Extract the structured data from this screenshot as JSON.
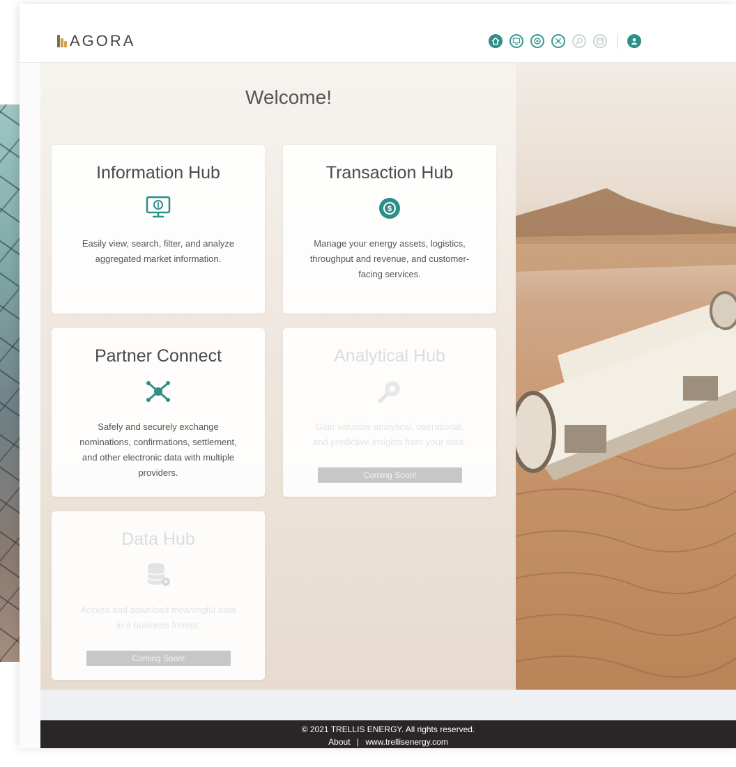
{
  "app": {
    "logo_text": "AGORA"
  },
  "header": {
    "nav_icons": [
      "home-icon",
      "information-hub-icon",
      "transaction-hub-icon",
      "partner-connect-icon",
      "analytical-hub-icon",
      "data-hub-icon",
      "user-profile-icon"
    ],
    "accent_color": "#2e8f88"
  },
  "main": {
    "welcome": "Welcome!",
    "cards": {
      "information_hub": {
        "title": "Information Hub",
        "description": "Easily view, search, filter, and analyze aggregated market information."
      },
      "transaction_hub": {
        "title": "Transaction Hub",
        "description": "Manage your energy assets, logistics, throughput and revenue, and customer-facing services."
      },
      "partner_connect": {
        "title": "Partner Connect",
        "description": "Safely and securely exchange nominations, confirmations, settlement, and other electronic data with multiple providers."
      },
      "analytical_hub": {
        "title": "Analytical Hub",
        "description": "Gain valuable analytical, operational, and predictive insights from your data.",
        "badge": "Coming Soon!"
      },
      "data_hub": {
        "title": "Data Hub",
        "description": "Access and download meaningful data in a business format.",
        "badge": "Coming Soon!"
      }
    }
  },
  "footer": {
    "copyright": "© 2021 TRELLIS ENERGY. All rights reserved.",
    "about": "About",
    "separator": "|",
    "website": "www.trellisenergy.com"
  }
}
